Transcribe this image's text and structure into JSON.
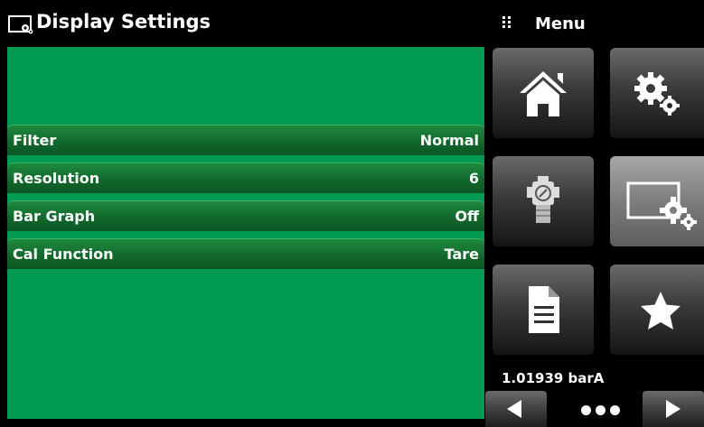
{
  "header": {
    "title": "Display Settings",
    "title_icon": "display-settings-icon"
  },
  "menu": {
    "label": "Menu",
    "icon": "grid-dots-icon"
  },
  "settings": [
    {
      "label": "Filter",
      "value": "Normal"
    },
    {
      "label": "Resolution",
      "value": "6"
    },
    {
      "label": "Bar Graph",
      "value": "Off"
    },
    {
      "label": "Cal Function",
      "value": "Tare"
    }
  ],
  "tiles": [
    {
      "icon": "home-icon"
    },
    {
      "icon": "settings-gears-icon"
    },
    {
      "icon": "pressure-gauge-icon"
    },
    {
      "icon": "display-settings-icon",
      "selected": true
    },
    {
      "icon": "document-icon"
    },
    {
      "icon": "star-icon"
    }
  ],
  "status": {
    "pressure_reading": "1.01939 barA"
  },
  "pagination": {
    "prev_icon": "arrow-left-icon",
    "next_icon": "arrow-right-icon",
    "dots_icon": "page-dots-icon"
  },
  "colors": {
    "panel_green": "#009b52",
    "row_green": "#12692c",
    "background": "#000000",
    "tile_gray": "#3a3a3a",
    "tile_selected": "#7d7d7d"
  }
}
